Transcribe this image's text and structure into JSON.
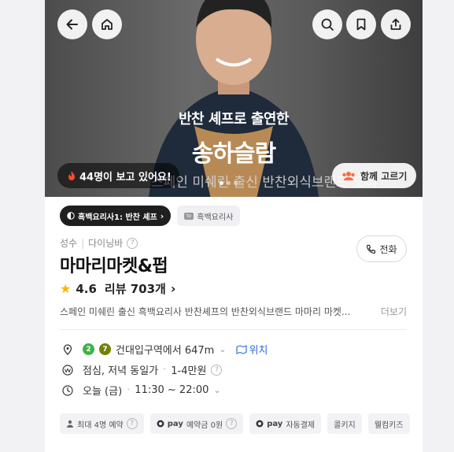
{
  "hero": {
    "caption_line1": "반찬 셰프로 출연한",
    "caption_line2": "송하슬람",
    "caption_line3": "스페인 미쉐린 출신 반찬외식브랜드 오너",
    "viewer_text": "44명이 보고 있어요!",
    "together_label": "함께 고르기",
    "slide_count": 3,
    "active_slide": 1
  },
  "tags": {
    "program_label": "흑백요리사1: 반찬 셰프",
    "tv_label": "흑백요리사",
    "tv_icon_text": "tv"
  },
  "place": {
    "area": "성수",
    "category": "다이닝바",
    "name": "마마리마켓&펍",
    "rating": "4.6",
    "review_label": "리뷰 703개",
    "description": "스페인 미쉐린 출신 흑백요리사 반찬셰프의 반찬외식브랜드 마마리 마켓...",
    "more_label": "더보기",
    "call_label": "전화"
  },
  "info": {
    "subway_lines": [
      {
        "num": "2",
        "color": "#3cb44a"
      },
      {
        "num": "7",
        "color": "#747f00"
      }
    ],
    "distance": "건대입구역에서 647m",
    "map_label": "위치",
    "meal": "점심, 저녁 동일가",
    "price": "1-4만원",
    "today": "오늘 (금)",
    "hours": "11:30 ~ 22:00"
  },
  "chips": {
    "max_reserve": "최대 4명 예약",
    "pay_label": "pay",
    "deposit": "예약금 0원",
    "auto_pay": "자동결제",
    "corkage": "콜키지",
    "welcome_kids": "웰컴키즈"
  },
  "colors": {
    "accent_blue": "#2d6fd6",
    "star": "#f5b800",
    "flame": "#ff4b2b",
    "group": "#ff6b3d"
  }
}
